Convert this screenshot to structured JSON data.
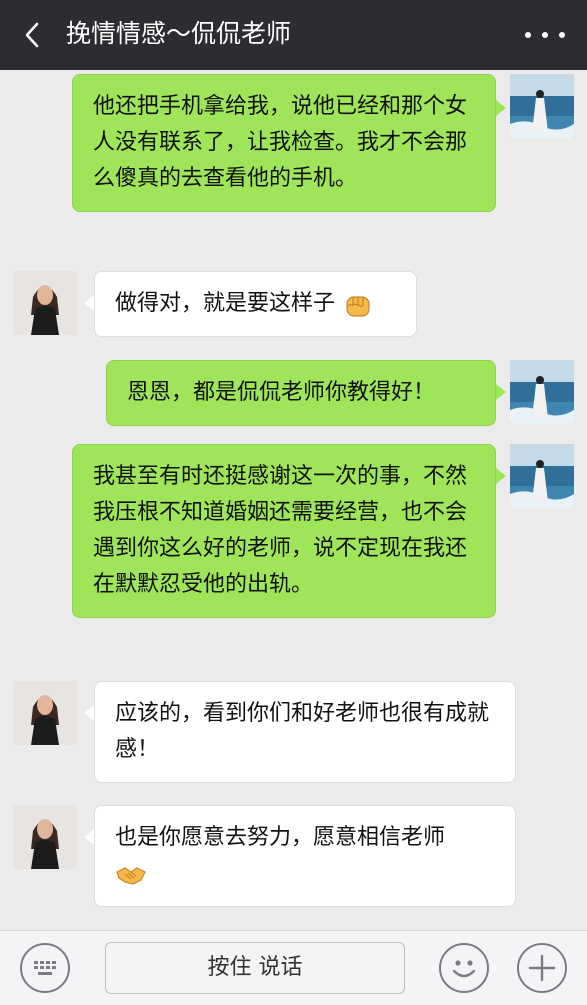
{
  "header": {
    "title": "挽情情感～侃侃老师",
    "back_icon": "chevron-left-icon",
    "more_icon": "more-dots-icon"
  },
  "messages": [
    {
      "sender": "me",
      "text": "他还把手机拿给我，说他已经和那个女人没有联系了，让我检查。我才不会那么傻真的去查看他的手机。"
    },
    {
      "sender": "other",
      "text": "做得对，就是要这样子",
      "emoji": "fist-emoji"
    },
    {
      "sender": "me",
      "text": "恩恩，都是侃侃老师你教得好！"
    },
    {
      "sender": "me",
      "text": "我甚至有时还挺感谢这一次的事，不然我压根不知道婚姻还需要经营，也不会遇到你这么好的老师，说不定现在我还在默默忍受他的出轨。"
    },
    {
      "sender": "other",
      "text": "应该的，看到你们和好老师也很有成就感！"
    },
    {
      "sender": "other",
      "text": "也是你愿意去努力，愿意相信老师",
      "emoji": "handshake-emoji"
    }
  ],
  "input_bar": {
    "hold_to_talk_label": "按住 说话",
    "keyboard_icon": "keyboard-icon",
    "emoji_icon": "smiley-icon",
    "add_icon": "plus-icon"
  },
  "colors": {
    "header_bg": "#2c2c31",
    "chat_bg": "#ebebeb",
    "my_bubble": "#9fe55a",
    "other_bubble": "#ffffff"
  }
}
